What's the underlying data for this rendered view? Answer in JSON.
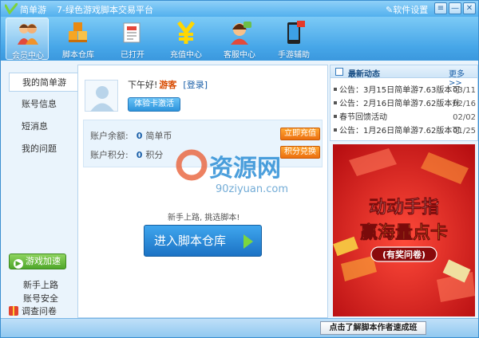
{
  "app": {
    "name": "简单游",
    "version_title": "7-绿色游戏脚本交易平台",
    "settings_label": "软件设置"
  },
  "window_controls": [
    "≡",
    "—",
    "✕"
  ],
  "toolbar": [
    {
      "label": "会员中心",
      "icon": "member-icon",
      "active": true
    },
    {
      "label": "脚本仓库",
      "icon": "cubes-icon",
      "active": false
    },
    {
      "label": "已打开",
      "icon": "document-icon",
      "active": false
    },
    {
      "label": "充值中心",
      "icon": "yen-icon",
      "active": false
    },
    {
      "label": "客服中心",
      "icon": "support-icon",
      "active": false
    },
    {
      "label": "手游辅助",
      "icon": "phone-icon",
      "active": false
    }
  ],
  "nav": [
    {
      "label": "我的简单游",
      "active": true
    },
    {
      "label": "账号信息",
      "active": false
    },
    {
      "label": "短消息",
      "active": false
    },
    {
      "label": "我的问题",
      "active": false
    }
  ],
  "sidebar_bottom": {
    "speed_label": "游戏加速",
    "links": [
      "新手上路",
      "账号安全"
    ],
    "survey_label": "调查问卷"
  },
  "profile": {
    "greeting": "下午好!",
    "username": "游客",
    "login_label": "[登录]",
    "trial_button": "体验卡激活"
  },
  "account": {
    "balance_label": "账户余额:",
    "balance_value": "0",
    "balance_unit": "简单币",
    "recharge_button": "立即充值",
    "points_label": "账户积分:",
    "points_value": "0",
    "points_unit": "积分",
    "exchange_button": "积分兑换"
  },
  "watermark": {
    "brand": "资源网",
    "url": "90ziyuan.com"
  },
  "cta": {
    "hint": "新手上路, 挑选脚本!",
    "button": "进入脚本仓库"
  },
  "news": {
    "title": "最新动态",
    "more": "更多>>",
    "items": [
      {
        "text": "公告：3月15日简单游7.63版本可",
        "date": "03/11"
      },
      {
        "text": "公告：2月16日简单游7.62版本升",
        "date": "02/16"
      },
      {
        "text": "春节回馈活动",
        "date": "02/02"
      },
      {
        "text": "公告：1月26日简单游7.62版本可",
        "date": "01/25"
      }
    ]
  },
  "banner": {
    "line1": "动动手指",
    "line2": "赢海量点卡",
    "line3": "(有奖问卷)"
  },
  "status": {
    "button": "点击了解脚本作者速成班"
  },
  "colors": {
    "titlebar": "#52b0ee",
    "accent_blue": "#1b72c4",
    "orange": "#ec6f0f",
    "green": "#4fa72a",
    "banner_red": "#d81e1e",
    "banner_yellow": "#ffe23a"
  }
}
